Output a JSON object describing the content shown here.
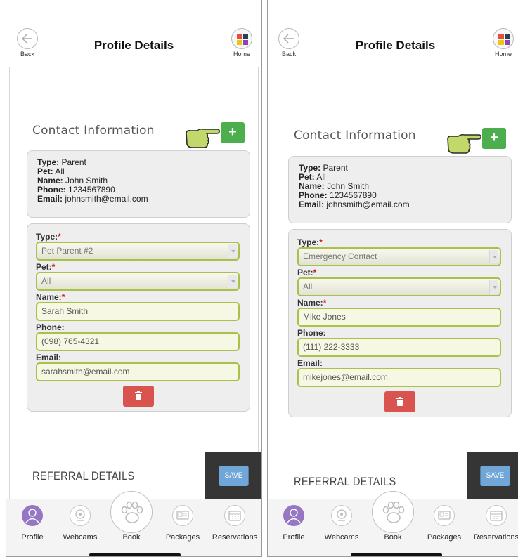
{
  "screens": [
    {
      "header": {
        "back_label": "Back",
        "title": "Profile Details",
        "home_label": "Home"
      },
      "contact_section": {
        "title": "Contact Information",
        "add_label": "+"
      },
      "summary": {
        "type_label": "Type:",
        "type_value": "Parent",
        "pet_label": "Pet:",
        "pet_value": "All",
        "name_label": "Name:",
        "name_value": "John Smith",
        "phone_label": "Phone:",
        "phone_value": "1234567890",
        "email_label": "Email:",
        "email_value": "johnsmith@email.com"
      },
      "form": {
        "type_label": "Type:",
        "type_value": "Pet Parent #2",
        "pet_label": "Pet:",
        "pet_value": "All",
        "name_label": "Name:",
        "name_value": "Sarah Smith",
        "phone_label": "Phone:",
        "phone_value": "(098) 765-4321",
        "email_label": "Email:",
        "email_value": "sarahsmith@email.com",
        "required_mark": "*"
      },
      "referral_title": "REFERRAL DETAILS",
      "save_label": "SAVE",
      "tabs": [
        "Profile",
        "Webcams",
        "Book",
        "Packages",
        "Reservations"
      ]
    },
    {
      "header": {
        "back_label": "Back",
        "title": "Profile Details",
        "home_label": "Home"
      },
      "contact_section": {
        "title": "Contact Information",
        "add_label": "+"
      },
      "summary": {
        "type_label": "Type:",
        "type_value": "Parent",
        "pet_label": "Pet:",
        "pet_value": "All",
        "name_label": "Name:",
        "name_value": "John Smith",
        "phone_label": "Phone:",
        "phone_value": "1234567890",
        "email_label": "Email:",
        "email_value": "johnsmith@email.com"
      },
      "form": {
        "type_label": "Type:",
        "type_value": "Emergency Contact",
        "pet_label": "Pet:",
        "pet_value": "All",
        "name_label": "Name:",
        "name_value": "Mike Jones",
        "phone_label": "Phone:",
        "phone_value": "(111) 222-3333",
        "email_label": "Email:",
        "email_value": "mikejones@email.com",
        "required_mark": "*"
      },
      "referral_title": "REFERRAL DETAILS",
      "save_label": "SAVE",
      "tabs": [
        "Profile",
        "Webcams",
        "Book",
        "Packages",
        "Reservations"
      ]
    }
  ],
  "icons": {
    "back": "arrow-left-icon",
    "home": "app-logo-icon",
    "add_pointer": "pointing-hand-icon",
    "delete": "trash-icon",
    "tabs": [
      "person-icon",
      "webcam-icon",
      "paw-icon",
      "id-card-icon",
      "calendar-icon"
    ]
  },
  "colors": {
    "accent_green": "#4cae4c",
    "field_border": "#a9c14a",
    "delete_red": "#d9534f",
    "save_blue": "#70a6d8",
    "profile_active": "#9677c4",
    "required_red": "#cc2222"
  }
}
